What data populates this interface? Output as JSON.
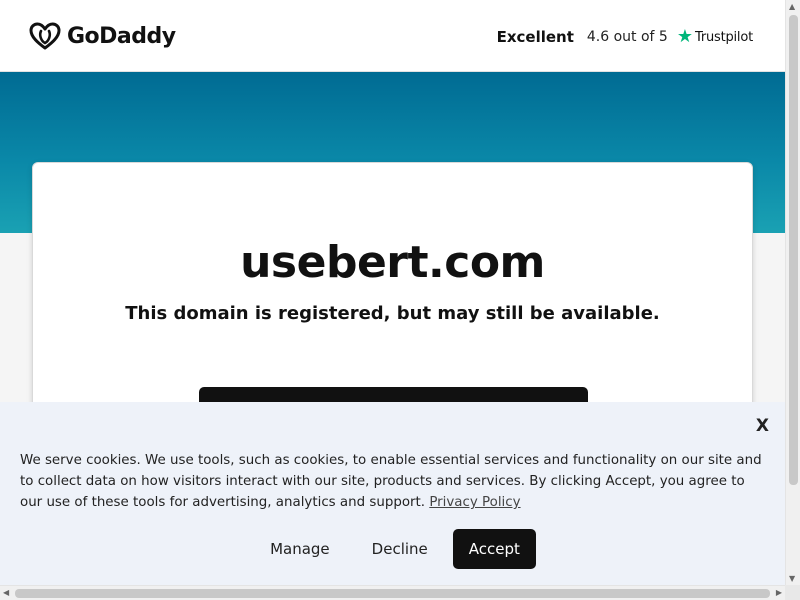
{
  "header": {
    "brand": "GoDaddy",
    "logo_icon": "godaddy-heart-logo",
    "rating_label": "Excellent",
    "rating_score": "4.6 out of 5",
    "trustpilot_icon": "trustpilot-star-icon",
    "trustpilot_name": "Trustpilot"
  },
  "hero": {
    "domain": "usebert.com",
    "subtitle": "This domain is registered, but may still be available."
  },
  "cookie_banner": {
    "close_label": "X",
    "text": "We serve cookies. We use tools, such as cookies, to enable essential services and functionality on our site and to collect data on how visitors interact with our site, products and services. By clicking Accept, you agree to our use of these tools for advertising, analytics and support.",
    "privacy_link": "Privacy Policy",
    "manage_label": "Manage",
    "decline_label": "Decline",
    "accept_label": "Accept"
  },
  "colors": {
    "hero_top": "#006b93",
    "hero_bottom": "#1aa1b3",
    "trustpilot_green": "#00b67a",
    "banner_bg": "#eef2f9"
  }
}
